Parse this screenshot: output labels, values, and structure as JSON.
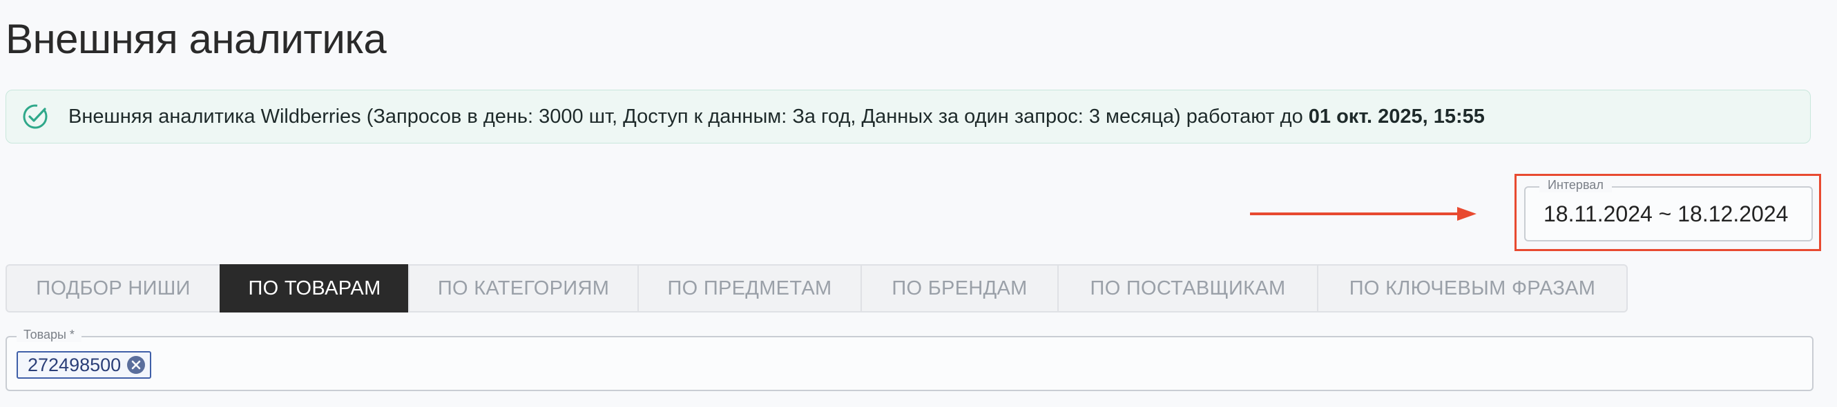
{
  "page": {
    "title": "Внешняя аналитика"
  },
  "alert": {
    "icon": "check-circle-icon",
    "text": "Внешняя аналитика Wildberries (Запросов в день: 3000 шт, Доступ к данным: За год, Данных за один запрос: 3 месяца) работают до ",
    "expiry": "01 окт. 2025, 15:55",
    "accent_color": "#2fa88a"
  },
  "interval": {
    "label": "Интервал",
    "value": "18.11.2024 ~ 18.12.2024",
    "highlight_color": "#e84a30"
  },
  "tabs": [
    {
      "label": "ПОДБОР НИШИ",
      "active": false
    },
    {
      "label": "ПО ТОВАРАМ",
      "active": true
    },
    {
      "label": "ПО КАТЕГОРИЯМ",
      "active": false
    },
    {
      "label": "ПО ПРЕДМЕТАМ",
      "active": false
    },
    {
      "label": "ПО БРЕНДАМ",
      "active": false
    },
    {
      "label": "ПО ПОСТАВЩИКАМ",
      "active": false
    },
    {
      "label": "ПО КЛЮЧЕВЫМ ФРАЗАМ",
      "active": false
    }
  ],
  "products": {
    "label": "Товары *",
    "chips": [
      {
        "value": "272498500",
        "remove_icon": "close-circle-icon"
      }
    ]
  }
}
